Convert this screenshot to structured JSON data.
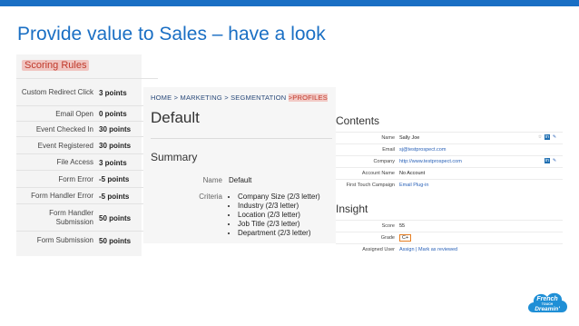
{
  "slide": {
    "title": "Provide value to Sales – have a look"
  },
  "scoring": {
    "title": "Scoring Rules",
    "rows": [
      {
        "label": "Custom Redirect Click",
        "value": "3 points"
      },
      {
        "label": "Email Open",
        "value": "0 points"
      },
      {
        "label": "Event Checked In",
        "value": "30 points"
      },
      {
        "label": "Event Registered",
        "value": "30 points"
      },
      {
        "label": "File Access",
        "value": "3 points"
      },
      {
        "label": "Form Error",
        "value": "-5 points"
      },
      {
        "label": "Form Handler Error",
        "value": "-5 points"
      },
      {
        "label": "Form Handler Submission",
        "value": "50 points"
      },
      {
        "label": "Form Submission",
        "value": "50 points"
      }
    ]
  },
  "center": {
    "breadcrumb": [
      "HOME",
      "MARKETING",
      "SEGMENTATION"
    ],
    "breadcrumb_sep": ">",
    "breadcrumb_current": "PROFILES",
    "heading": "Default",
    "summary_heading": "Summary",
    "name_label": "Name",
    "name_value": "Default",
    "criteria_label": "Criteria",
    "criteria": [
      "Company Size (2/3 letter)",
      "Industry (2/3 letter)",
      "Location (2/3 letter)",
      "Job Title (2/3 letter)",
      "Department (2/3 letter)"
    ]
  },
  "right": {
    "contents_heading": "Contents",
    "insight_heading": "Insight",
    "contents_rows": [
      {
        "label": "Name",
        "value": "Sally Joe"
      },
      {
        "label": "Email",
        "value": "sj@testprospect.com"
      },
      {
        "label": "Company",
        "value": "http://www.testprospect.com"
      },
      {
        "label": "Account Name",
        "value": "No Account"
      },
      {
        "label": "First Touch Campaign",
        "value": "Email Plug-in"
      }
    ],
    "insight_rows": [
      {
        "label": "Score",
        "value": "55"
      },
      {
        "label": "Grade",
        "value": "C+"
      },
      {
        "label": "Assigned User",
        "value": "Assign | Mark as reviewed"
      }
    ]
  },
  "logo": {
    "line1": "French",
    "line2": "TOUCH",
    "line3": "Dreamin'"
  }
}
